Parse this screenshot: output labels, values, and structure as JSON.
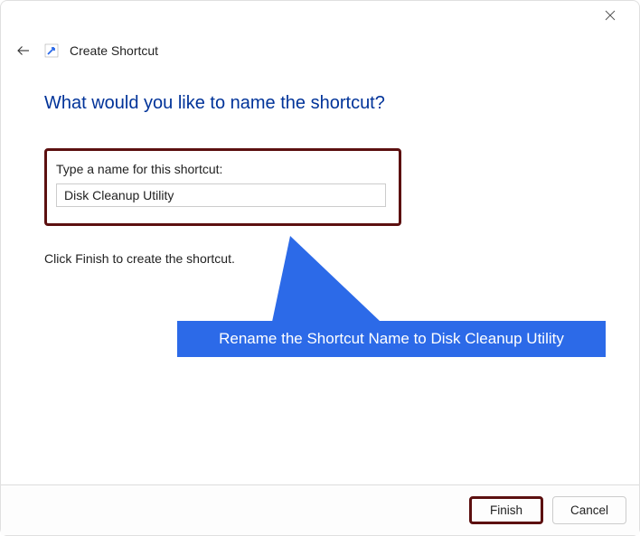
{
  "titlebar": {
    "close_icon": "close"
  },
  "header": {
    "title": "Create Shortcut"
  },
  "content": {
    "heading": "What would you like to name the shortcut?",
    "input_label": "Type a name for this shortcut:",
    "input_value": "Disk Cleanup Utility",
    "hint": "Click Finish to create the shortcut."
  },
  "callout": {
    "text": "Rename the Shortcut Name to Disk Cleanup Utility"
  },
  "footer": {
    "finish_label": "Finish",
    "cancel_label": "Cancel"
  }
}
